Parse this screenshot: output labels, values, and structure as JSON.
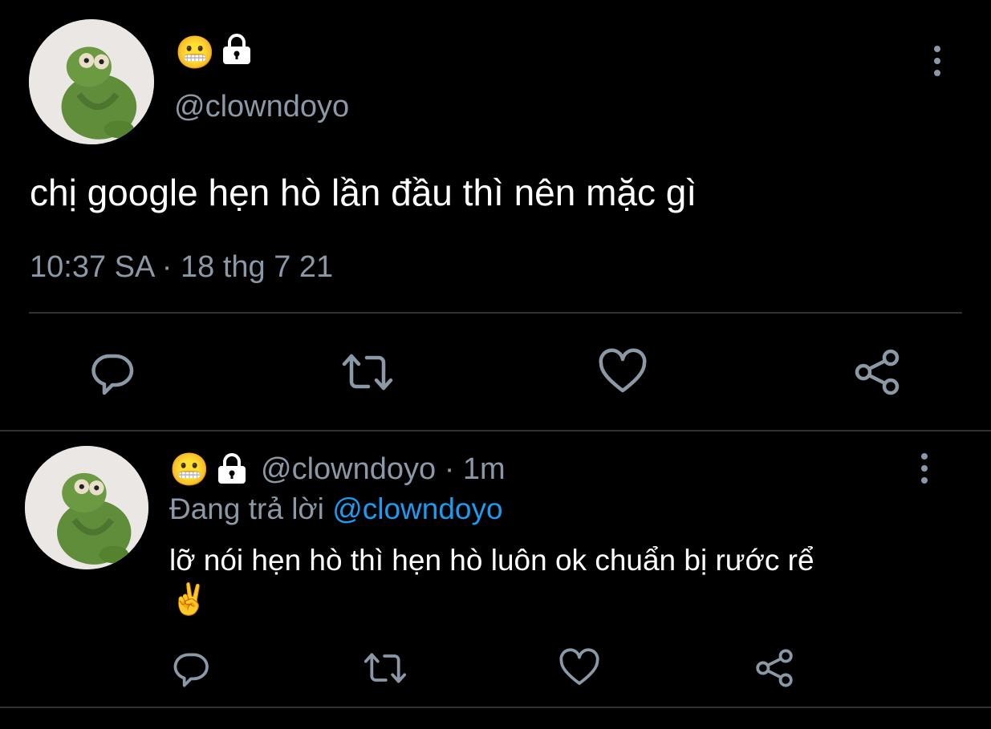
{
  "main_tweet": {
    "avatar_icon": "kermit-avatar",
    "status_emoji": "😬",
    "lock_icon": "lock-icon",
    "handle": "@clowndoyo",
    "text": "chị google hẹn hò lần đầu thì nên mặc gì",
    "timestamp": "10:37 SA · 18 thg 7 21",
    "actions": [
      "reply-icon",
      "retweet-icon",
      "like-icon",
      "share-icon"
    ]
  },
  "reply_tweet": {
    "avatar_icon": "kermit-avatar",
    "status_emoji": "😬",
    "lock_icon": "lock-icon",
    "handle": "@clowndoyo",
    "time_ago": "· 1m",
    "replying_prefix": "Đang trả lời",
    "replying_to": "@clowndoyo",
    "text": "lỡ nói hẹn hò thì hẹn hò luôn ok chuẩn bị rước rể",
    "trailing_emoji": "✌️",
    "actions": [
      "reply-icon",
      "retweet-icon",
      "like-icon",
      "share-icon"
    ]
  },
  "colors": {
    "background": "#000000",
    "text": "#ffffff",
    "muted": "#8b98a5",
    "link": "#1d9bf0",
    "divider": "#2f3336"
  }
}
